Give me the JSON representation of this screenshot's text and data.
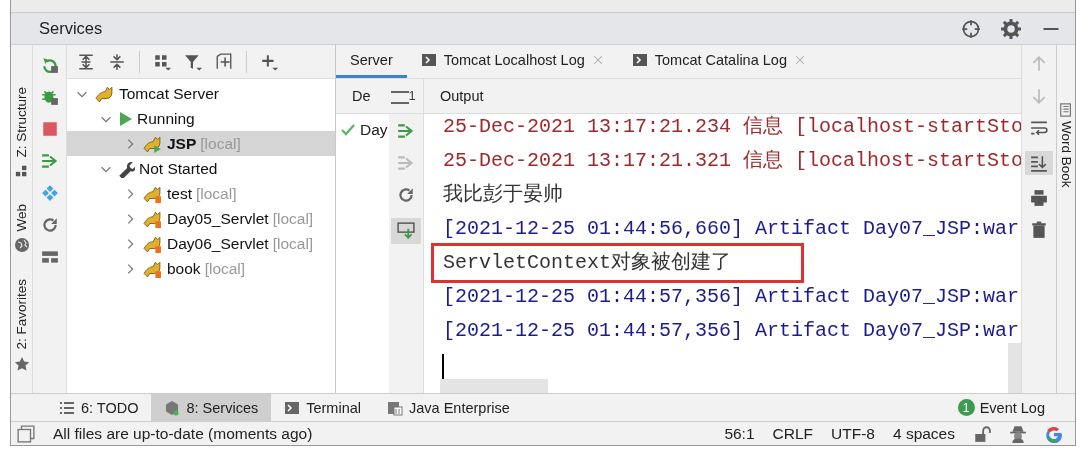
{
  "panel": {
    "title": "Services"
  },
  "left_stripe": [
    {
      "label": "Z: Structure"
    },
    {
      "label": "Web"
    },
    {
      "label": "2: Favorites"
    }
  ],
  "tree": [
    {
      "label": "Tomcat Server",
      "kind": "server",
      "expanded": true,
      "selected": false,
      "children": [
        {
          "label": "Running",
          "kind": "running-group",
          "expanded": true,
          "selected": false,
          "children": [
            {
              "label": "JSP",
              "suffix": "[local]",
              "kind": "running",
              "expanded": false,
              "selected": true
            }
          ]
        },
        {
          "label": "Not Started",
          "kind": "stopped-group",
          "expanded": true,
          "selected": false,
          "children": [
            {
              "label": "test",
              "suffix": "[local]",
              "kind": "stopped",
              "expanded": false,
              "selected": false
            },
            {
              "label": "Day05_Servlet",
              "suffix": "[local]",
              "kind": "stopped",
              "expanded": false,
              "selected": false
            },
            {
              "label": "Day06_Servlet",
              "suffix": "[local]",
              "kind": "stopped",
              "expanded": false,
              "selected": false
            },
            {
              "label": "book",
              "suffix": "[local]",
              "kind": "stopped",
              "expanded": false,
              "selected": false
            }
          ]
        }
      ]
    }
  ],
  "tabs": [
    {
      "label": "Server",
      "selected": true,
      "closable": false
    },
    {
      "label": "Tomcat Localhost Log",
      "selected": false,
      "closable": true
    },
    {
      "label": "Tomcat Catalina Log",
      "selected": false,
      "closable": true
    }
  ],
  "deploy_header": {
    "label": "De",
    "count": "1"
  },
  "output_header": "Output",
  "deployments": [
    {
      "label": "Day",
      "deployed": true
    }
  ],
  "log": [
    {
      "text": "25-Dec-2021 13:17:21.234 信息 [localhost-startSto",
      "kind": "info",
      "highlighted": false
    },
    {
      "text": "25-Dec-2021 13:17:21.321 信息 [localhost-startSto",
      "kind": "info",
      "highlighted": false
    },
    {
      "text": "我比彭于晏帅",
      "kind": "plain",
      "highlighted": false
    },
    {
      "text": "[2021-12-25 01:44:56,660] Artifact Day07_JSP:war",
      "kind": "artifact",
      "highlighted": false
    },
    {
      "text": "ServletContext对象被创建了",
      "kind": "plain",
      "highlighted": true
    },
    {
      "text": "[2021-12-25 01:44:57,356] Artifact Day07_JSP:war",
      "kind": "artifact",
      "highlighted": false
    },
    {
      "text": "[2021-12-25 01:44:57,356] Artifact Day07_JSP:war",
      "kind": "artifact",
      "highlighted": false
    }
  ],
  "right_stripe": [
    {
      "label": "Word Book"
    }
  ],
  "tool_windows": [
    {
      "label": "6: TODO",
      "kind": "list",
      "selected": false
    },
    {
      "label": "8: Services",
      "kind": "services",
      "selected": true
    },
    {
      "label": "Terminal",
      "kind": "terminal",
      "selected": false
    },
    {
      "label": "Java Enterprise",
      "kind": "enterprise",
      "selected": false
    }
  ],
  "event_log": {
    "label": "Event Log",
    "badge": "1"
  },
  "status": {
    "message": "All files are up-to-date (moments ago)",
    "position": "56:1",
    "line_separator": "CRLF",
    "encoding": "UTF-8",
    "indent": "4 spaces"
  }
}
